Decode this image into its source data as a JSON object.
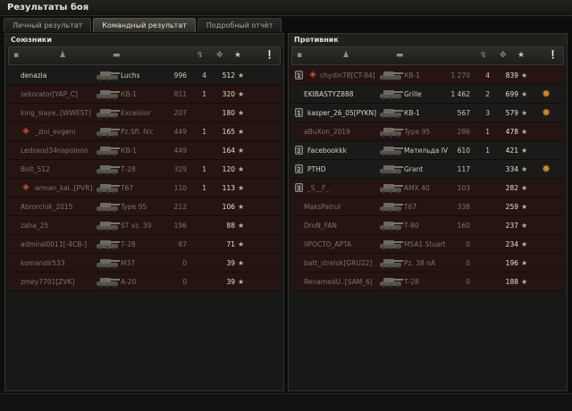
{
  "window": {
    "title": "Результаты боя"
  },
  "tabs": [
    {
      "label": "Личный результат",
      "active": false
    },
    {
      "label": "Командный результат",
      "active": true
    },
    {
      "label": "Подробный отчёт",
      "active": false
    }
  ],
  "allies": {
    "title": "Союзники",
    "players": [
      {
        "platoon": "",
        "clan": false,
        "name": "denazia",
        "tank": "Luchs",
        "damage": "996",
        "kills": "4",
        "xp": "512",
        "alive": true
      },
      {
        "platoon": "",
        "clan": false,
        "name": "sekorator[YAP_C]",
        "tank": "КВ-1",
        "damage": "811",
        "kills": "1",
        "xp": "320",
        "alive": false
      },
      {
        "platoon": "",
        "clan": false,
        "name": "king_slaye..[WWEST]",
        "tank": "Excelsior",
        "damage": "207",
        "kills": "",
        "xp": "180",
        "alive": false
      },
      {
        "platoon": "",
        "clan": true,
        "name": "_zloi_evgeni",
        "tank": "Pz.Sfl. IVc",
        "damage": "449",
        "kills": "1",
        "xp": "165",
        "alive": false
      },
      {
        "platoon": "",
        "clan": false,
        "name": "Ledoxod34napoleon",
        "tank": "КВ-1",
        "damage": "449",
        "kills": "",
        "xp": "164",
        "alive": false
      },
      {
        "platoon": "",
        "clan": false,
        "name": "Bolt_512",
        "tank": "Т-28",
        "damage": "329",
        "kills": "1",
        "xp": "120",
        "alive": false
      },
      {
        "platoon": "",
        "clan": true,
        "name": "arman_kal..[PVR]",
        "tank": "T67",
        "damage": "110",
        "kills": "1",
        "xp": "113",
        "alive": false
      },
      {
        "platoon": "",
        "clan": false,
        "name": "Abrorchik_2015",
        "tank": "Type 95",
        "damage": "212",
        "kills": "",
        "xp": "106",
        "alive": false
      },
      {
        "platoon": "",
        "clan": false,
        "name": "zaha_25",
        "tank": "ST vz. 39",
        "damage": "196",
        "kills": "",
        "xp": "88",
        "alive": false
      },
      {
        "platoon": "",
        "clan": false,
        "name": "admiral0011[-4CB-]",
        "tank": "Т-28",
        "damage": "87",
        "kills": "",
        "xp": "71",
        "alive": false
      },
      {
        "platoon": "",
        "clan": false,
        "name": "komandir533",
        "tank": "M37",
        "damage": "0",
        "kills": "",
        "xp": "39",
        "alive": false
      },
      {
        "platoon": "",
        "clan": false,
        "name": "zmey7701[ZVK]",
        "tank": "A-20",
        "damage": "0",
        "kills": "",
        "xp": "39",
        "alive": false
      }
    ]
  },
  "enemies": {
    "title": "Противник",
    "players": [
      {
        "platoon": "1",
        "clan": true,
        "name": "chydin78[CT-84]",
        "tank": "КВ-1",
        "damage": "1 270",
        "kills": "4",
        "xp": "839",
        "alive": false,
        "medal": false
      },
      {
        "platoon": "",
        "clan": false,
        "name": "EKIBASTYZ888",
        "tank": "Grille",
        "damage": "1 462",
        "kills": "2",
        "xp": "699",
        "alive": true,
        "medal": true
      },
      {
        "platoon": "1",
        "clan": false,
        "name": "kasper_26_05[PYKN]",
        "tank": "КВ-1",
        "damage": "567",
        "kills": "3",
        "xp": "579",
        "alive": true,
        "medal": true
      },
      {
        "platoon": "",
        "clan": false,
        "name": "aBuXon_2019",
        "tank": "Type 95",
        "damage": "286",
        "kills": "1",
        "xp": "478",
        "alive": false,
        "medal": false
      },
      {
        "platoon": "2",
        "clan": false,
        "name": "Facebookkk",
        "tank": "Матильда IV",
        "damage": "610",
        "kills": "1",
        "xp": "421",
        "alive": true,
        "medal": false
      },
      {
        "platoon": "2",
        "clan": false,
        "name": "PTHD",
        "tank": "Grant",
        "damage": "117",
        "kills": "",
        "xp": "334",
        "alive": true,
        "medal": true
      },
      {
        "platoon": "3",
        "clan": false,
        "name": "_S__F_",
        "tank": "AMX 40",
        "damage": "103",
        "kills": "",
        "xp": "282",
        "alive": false,
        "medal": false
      },
      {
        "platoon": "",
        "clan": false,
        "name": "MaksPatrul",
        "tank": "T67",
        "damage": "338",
        "kills": "",
        "xp": "259",
        "alive": false,
        "medal": false
      },
      {
        "platoon": "",
        "clan": false,
        "name": "DroN_FAN",
        "tank": "Т-80",
        "damage": "160",
        "kills": "",
        "xp": "237",
        "alive": false,
        "medal": false
      },
      {
        "platoon": "",
        "clan": false,
        "name": "IIPOCTO_APTA",
        "tank": "M5A1 Stuart",
        "damage": "0",
        "kills": "",
        "xp": "234",
        "alive": false,
        "medal": false
      },
      {
        "platoon": "",
        "clan": false,
        "name": "batt_strelok[GRU22]",
        "tank": "Pz. 38 nA",
        "damage": "0",
        "kills": "",
        "xp": "196",
        "alive": false,
        "medal": false
      },
      {
        "platoon": "",
        "clan": false,
        "name": "RenamedU..[SAM_6]",
        "tank": "Т-28",
        "damage": "0",
        "kills": "",
        "xp": "188",
        "alive": false,
        "medal": false
      }
    ]
  },
  "icons": {
    "platoon": "platoon-badge-icon",
    "player": "player-icon",
    "vehicle": "vehicle-icon",
    "damage": "damage-icon",
    "kills": "kills-icon",
    "xp": "xp-star-icon",
    "info": "info-icon"
  },
  "colors": {
    "accent_medal": "#c88a2a",
    "dead_row": "#251412",
    "clan_badge": "#c94f39"
  }
}
